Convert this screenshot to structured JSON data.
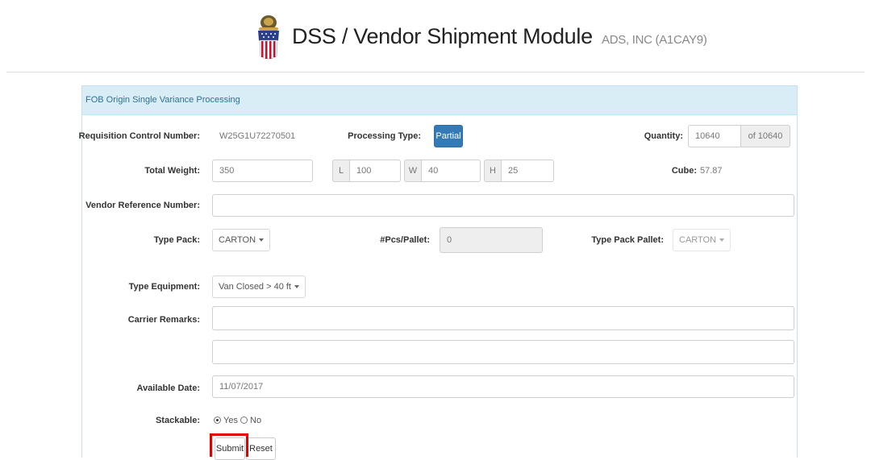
{
  "header": {
    "title": "DSS / Vendor Shipment Module",
    "company": "ADS, INC (A1CAY9)",
    "logo_icon": "dla-seal-icon"
  },
  "panel": {
    "heading": "FOB Origin Single Variance Processing"
  },
  "form": {
    "rcn_label": "Requisition Control Number:",
    "rcn_value": "W25G1U72270501",
    "processing_type_label": "Processing Type:",
    "processing_type_value": "Partial",
    "quantity_label": "Quantity:",
    "quantity_value": "10640",
    "quantity_total": "of 10640",
    "total_weight_label": "Total Weight:",
    "total_weight_value": "350",
    "length_label": "L",
    "length_value": "100",
    "width_label": "W",
    "width_value": "40",
    "height_label": "H",
    "height_value": "25",
    "cube_label": "Cube:",
    "cube_value": "57.87",
    "vendor_ref_label": "Vendor Reference Number:",
    "vendor_ref_value": "",
    "type_pack_label": "Type Pack:",
    "type_pack_value": "CARTON",
    "pcs_pallet_label": "#Pcs/Pallet:",
    "pcs_pallet_value": "0",
    "type_pack_pallet_label": "Type Pack Pallet:",
    "type_pack_pallet_value": "CARTON",
    "type_equipment_label": "Type Equipment:",
    "type_equipment_value": "Van Closed > 40 ft",
    "carrier_remarks_label": "Carrier Remarks:",
    "carrier_remarks_1": "",
    "carrier_remarks_2": "",
    "available_date_label": "Available Date:",
    "available_date_value": "11/07/2017",
    "stackable_label": "Stackable:",
    "stackable_yes": "Yes",
    "stackable_no": "No",
    "stackable_selected": "Yes"
  },
  "actions": {
    "submit_label": "Submit",
    "reset_label": "Reset"
  },
  "colors": {
    "heading_bg": "#d9edf7",
    "primary": "#337ab7",
    "highlight": "#e00000"
  }
}
